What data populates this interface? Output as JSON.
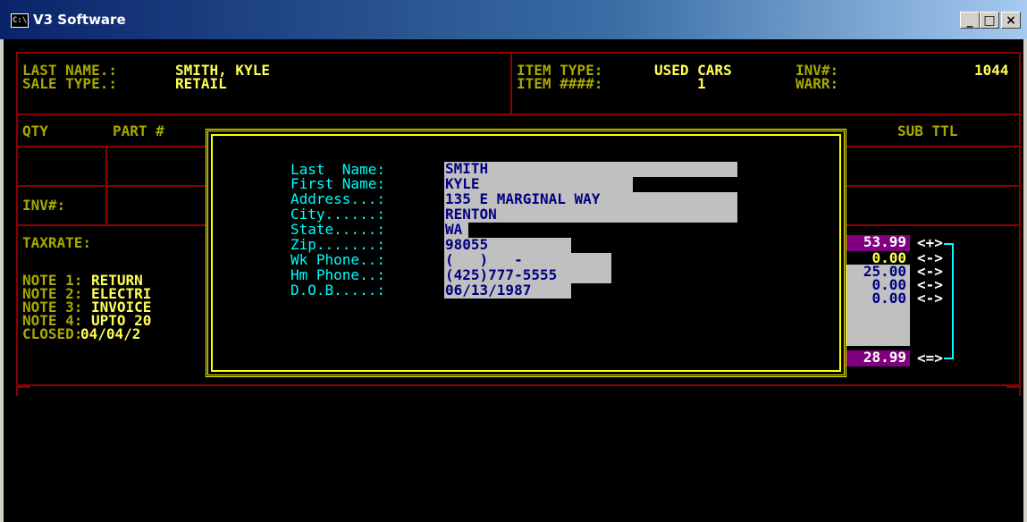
{
  "window": {
    "title": "V3 Software",
    "icon_glyph": "C:\\",
    "controls": {
      "minimize": "_",
      "maximize": "□",
      "close": "×"
    }
  },
  "header": {
    "last_name_label": "LAST NAME.:",
    "last_name_value": "SMITH, KYLE",
    "sale_type_label": "SALE TYPE.:",
    "sale_type_value": "RETAIL",
    "item_type_label": "ITEM TYPE:",
    "item_type_value": "USED CARS",
    "item_num_label": "ITEM ####:",
    "item_num_value": "1",
    "inv_label": "INV#:",
    "inv_value": "1044",
    "warr_label": "WARR:"
  },
  "grid": {
    "qty_header": "QTY",
    "part_header": "PART #",
    "subttl_header": "SUB TTL",
    "inv_label": "INV#:",
    "taxrate_label": "TAXRATE:"
  },
  "notes": [
    {
      "label": "NOTE 1:",
      "value": "RETURN"
    },
    {
      "label": "NOTE 2:",
      "value": "ELECTRI"
    },
    {
      "label": "NOTE 3:",
      "value": "INVOICE"
    },
    {
      "label": "NOTE 4:",
      "value": "UPTO 20"
    }
  ],
  "closed": {
    "label": "CLOSED:",
    "value": "04/04/2"
  },
  "totals": [
    {
      "value": "53.99",
      "op": "<+>",
      "bg": "#800080",
      "fg": "#ffffff"
    },
    {
      "value": "0.00",
      "op": "<->",
      "bg": "#000000",
      "fg": "#ffff55"
    },
    {
      "value": "25.00",
      "op": "<->",
      "bg": "#c0c0c0",
      "fg": "#000080"
    },
    {
      "value": "0.00",
      "op": "<->",
      "bg": "#c0c0c0",
      "fg": "#000080"
    },
    {
      "value": "0.00",
      "op": "<->",
      "bg": "#c0c0c0",
      "fg": "#000080"
    },
    {
      "value": "28.99",
      "op": "<=>",
      "bg": "#800080",
      "fg": "#ffffff"
    }
  ],
  "customer_form": {
    "last_name": {
      "label": "Last  Name:",
      "value": "SMITH"
    },
    "first_name": {
      "label": "First Name:",
      "value": "KYLE"
    },
    "address": {
      "label": "Address...:",
      "value": "135 E MARGINAL WAY"
    },
    "city": {
      "label": "City......:",
      "value": "RENTON"
    },
    "state": {
      "label": "State.....:",
      "value": "WA"
    },
    "zip": {
      "label": "Zip.......:",
      "value": "98055"
    },
    "wk_phone": {
      "label": "Wk Phone..:",
      "value": "(   )   -"
    },
    "hm_phone": {
      "label": "Hm Phone..:",
      "value": "(425)777-5555"
    },
    "dob": {
      "label": "D.O.B.....:",
      "value": "06/13/1987"
    }
  }
}
